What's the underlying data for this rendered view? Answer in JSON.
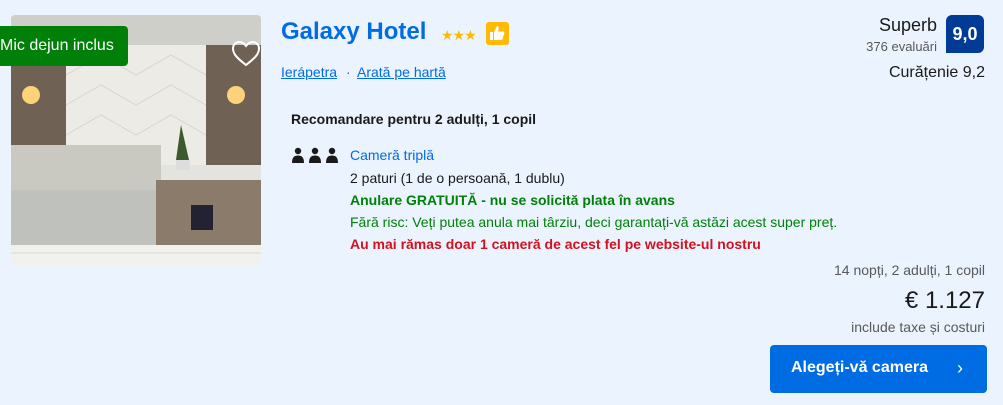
{
  "hotel": {
    "name": "Galaxy Hotel",
    "stars": "★★★",
    "location_link": "Ierápetra",
    "location_sep": "·",
    "map_link": "Arată pe hartă",
    "meal_badge": "Mic dejun inclus"
  },
  "review": {
    "word": "Superb",
    "count": "376 evaluări",
    "score": "9,0",
    "cleanliness": "Curățenie 9,2"
  },
  "room": {
    "recommendation": "Recomandare pentru 2 adulți, 1 copil",
    "type": "Cameră triplă",
    "beds": "2 paturi (1 de o persoană, 1 dublu)",
    "cancellation": "Anulare GRATUITĂ - nu se solicită plata în avans",
    "no_risk": "Fără risc: Veți putea anula mai târziu, deci garantați-vă astăzi acest super preț.",
    "scarcity": "Au mai rămas doar 1 cameră de acest fel pe website-ul nostru"
  },
  "pricing": {
    "stay": "14 nopți, 2 adulți, 1 copil",
    "price": "€ 1.127",
    "taxes": "include taxe și costuri"
  },
  "cta": {
    "label": "Alegeți-vă camera",
    "chevron": "›"
  },
  "icons": {
    "heart": "heart-icon",
    "thumb": "thumbs-up-icon",
    "people": "people-icon"
  },
  "colors": {
    "background": "#ebf3ff",
    "link": "#006ce4",
    "score_bg": "#003b95",
    "green": "#008009",
    "red": "#d4111e",
    "stars": "#febb02"
  }
}
